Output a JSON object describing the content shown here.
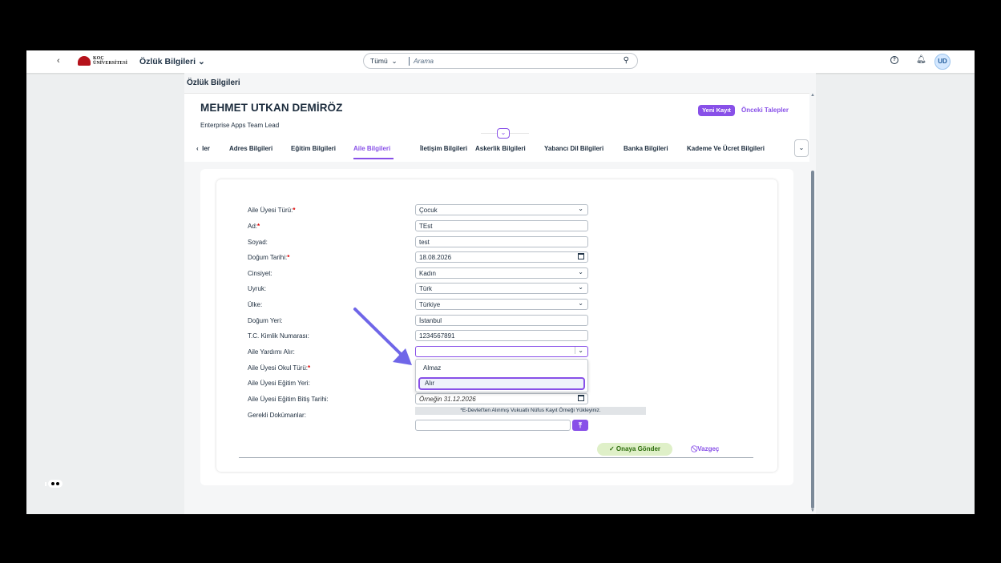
{
  "shell": {
    "app_title": "Özlük Bilgileri",
    "app_title_chevron": "chevron-down-icon",
    "logo_top": "KOÇ",
    "logo_bottom": "ÜNİVERSİTESİ",
    "search_scope": "Tümü",
    "search_placeholder": "Arama",
    "avatar_initials": "UD"
  },
  "page": {
    "title": "Özlük Bilgileri"
  },
  "header": {
    "name": "MEHMET UTKAN DEMİRÖZ",
    "role": "Enterprise Apps Team Lead",
    "new_record": "Yeni Kayıt",
    "previous_requests": "Önceki Talepler"
  },
  "tabs": [
    {
      "label": "ler"
    },
    {
      "label": "Adres Bilgileri"
    },
    {
      "label": "Eğitim Bilgileri"
    },
    {
      "label": "Aile Bilgileri",
      "active": true
    },
    {
      "label": "İletişim Bilgileri"
    },
    {
      "label": "Askerlik Bilgileri"
    },
    {
      "label": "Yabancı Dil Bilgileri"
    },
    {
      "label": "Banka Bilgileri"
    },
    {
      "label": "Kademe Ve Ücret Bilgileri"
    }
  ],
  "form": {
    "rows": [
      {
        "label": "Aile Üyesi Türü:",
        "required": true,
        "value": "Çocuk",
        "kind": "select"
      },
      {
        "label": "Ad:",
        "required": true,
        "value": "TEst",
        "kind": "text"
      },
      {
        "label": "Soyad:",
        "required": false,
        "value": "test",
        "kind": "text"
      },
      {
        "label": "Doğum Tarihi:",
        "required": true,
        "value": "18.08.2026",
        "kind": "date"
      },
      {
        "label": "Cinsiyet:",
        "required": false,
        "value": "Kadın",
        "kind": "select"
      },
      {
        "label": "Uyruk:",
        "required": false,
        "value": "Türk",
        "kind": "select"
      },
      {
        "label": "Ülke:",
        "required": false,
        "value": "Türkiye",
        "kind": "select"
      },
      {
        "label": "Doğum Yeri:",
        "required": false,
        "value": "İstanbul",
        "kind": "text"
      },
      {
        "label": "T.C. Kimlik Numarası:",
        "required": false,
        "value": "1234567891",
        "kind": "text"
      },
      {
        "label": "Aile Yardımı Alır:",
        "required": false,
        "value": "",
        "kind": "select-open"
      },
      {
        "label": "Aile Üyesi Okul Türü:",
        "required": true
      },
      {
        "label": "Aile Üyesi Eğitim Yeri:",
        "required": false
      },
      {
        "label": "Aile Üyesi Eğitim Bitiş Tarihi:",
        "required": false,
        "placeholder": "Örneğin 31.12.2026",
        "kind": "date"
      },
      {
        "label": "Gerekli Dokümanlar:",
        "required": false
      }
    ],
    "dropdown_options": [
      "Almaz",
      "Alır"
    ],
    "dropdown_selected": "Alır",
    "document_hint": "*E-Devlet'ten Alınmış Vukuatlı Nüfus Kayıt Örneği Yükleyiniz.",
    "submit_label": "Onaya Gönder",
    "cancel_label": "Vazgeç"
  },
  "colors": {
    "accent": "#8850e8",
    "approve_bg": "#dff0c8",
    "approve_text": "#2b6b0b",
    "required": "#dd0000"
  }
}
